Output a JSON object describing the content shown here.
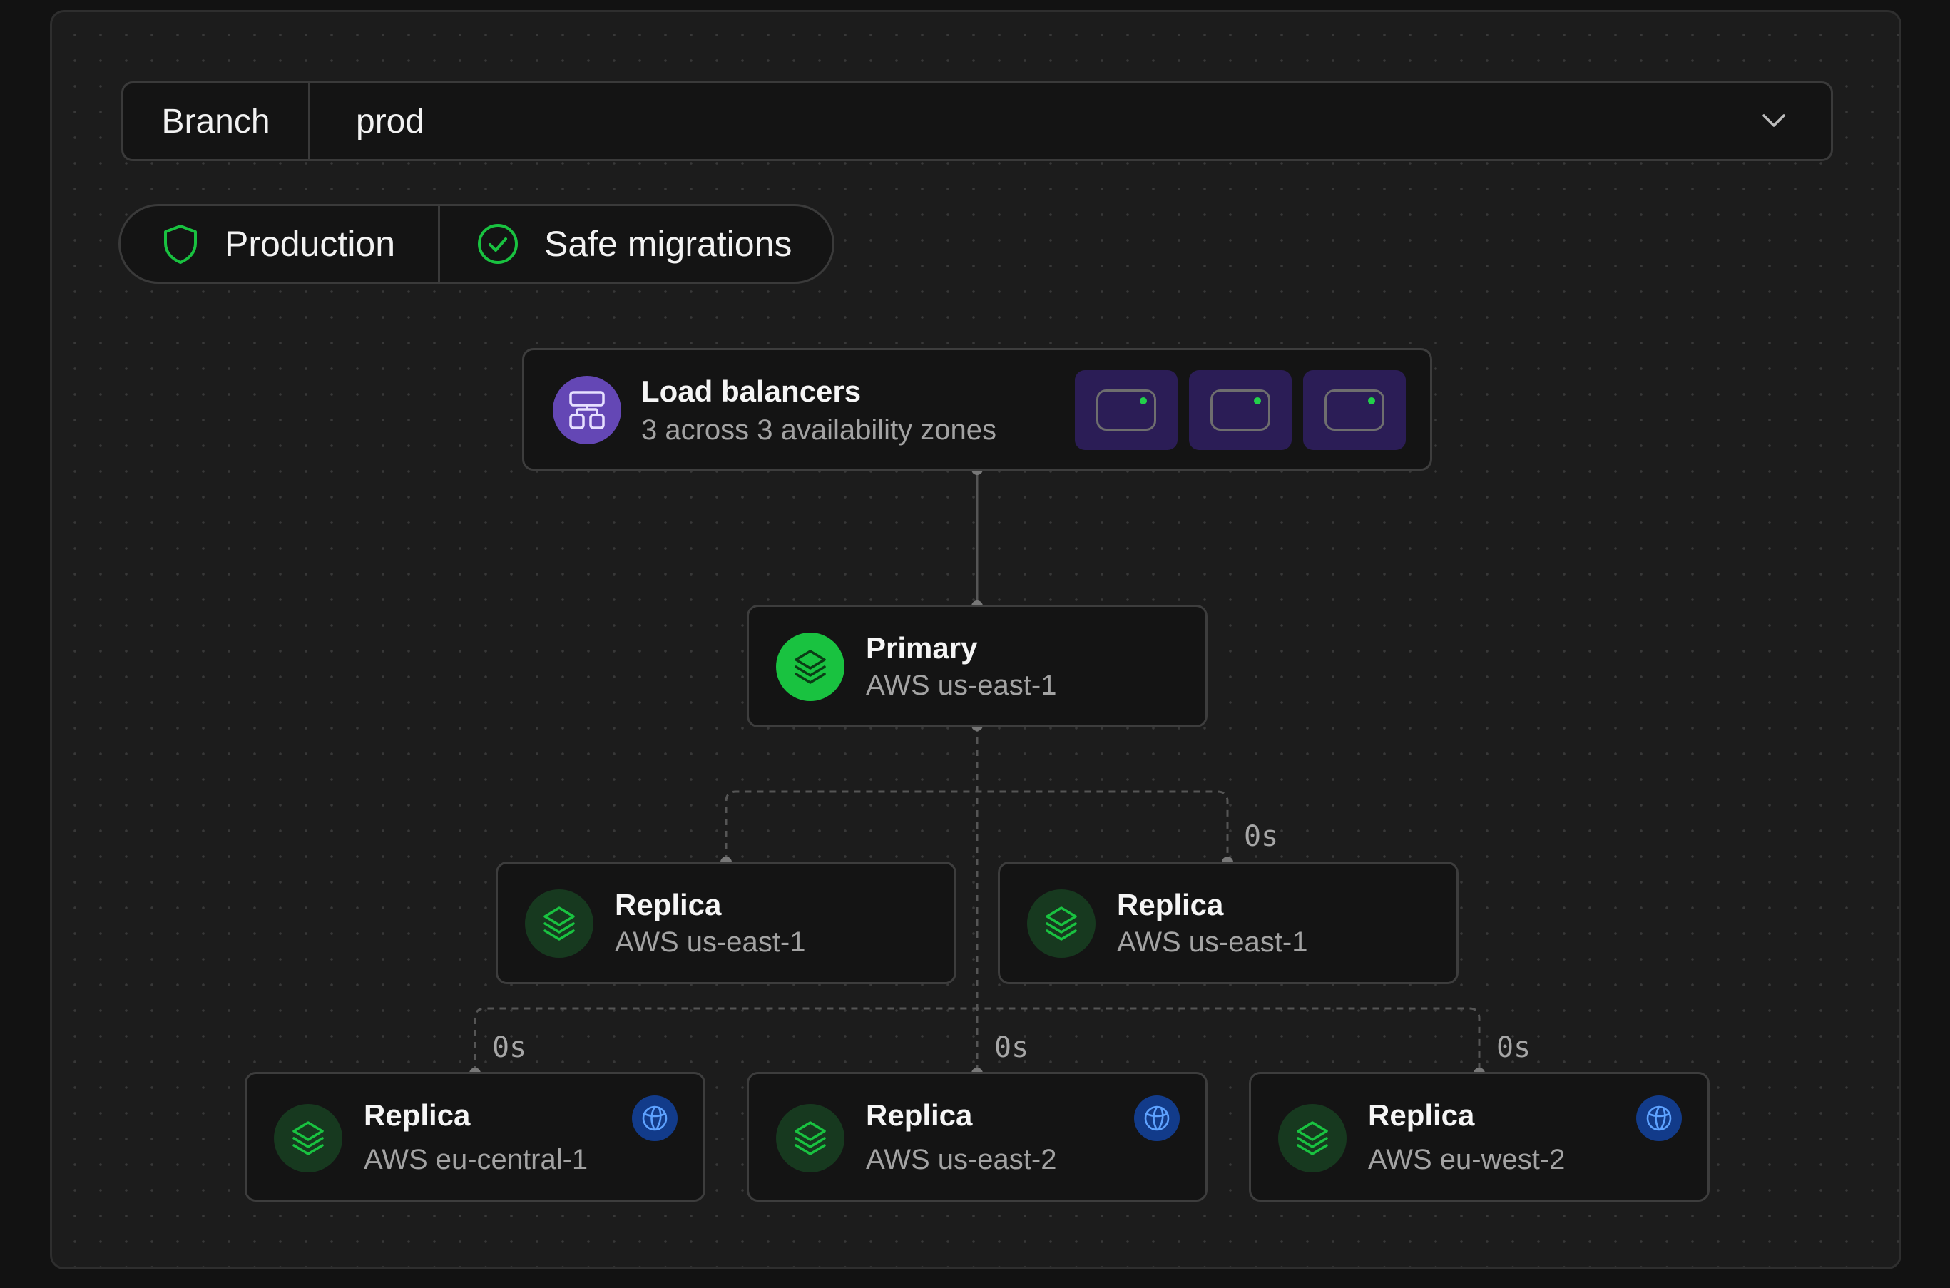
{
  "branch": {
    "label": "Branch",
    "value": "prod"
  },
  "badges": [
    {
      "label": "Production",
      "icon": "shield-icon"
    },
    {
      "label": "Safe migrations",
      "icon": "check-circle-icon"
    }
  ],
  "load_balancers": {
    "title": "Load balancers",
    "subtitle": "3 across 3 availability zones",
    "count": 3
  },
  "primary": {
    "title": "Primary",
    "region": "AWS us-east-1"
  },
  "replicas_tier1": [
    {
      "title": "Replica",
      "region": "AWS us-east-1"
    },
    {
      "title": "Replica",
      "region": "AWS us-east-1",
      "lag": "0s"
    }
  ],
  "replicas_tier2": [
    {
      "title": "Replica",
      "region": "AWS eu-central-1",
      "lag": "0s"
    },
    {
      "title": "Replica",
      "region": "AWS us-east-2",
      "lag": "0s"
    },
    {
      "title": "Replica",
      "region": "AWS eu-west-2",
      "lag": "0s"
    }
  ],
  "colors": {
    "accent_green": "#19c240",
    "purple": "#6447b5",
    "globe_blue": "#123b8a"
  }
}
